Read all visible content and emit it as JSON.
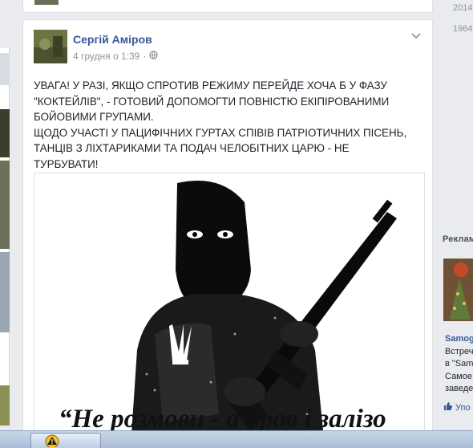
{
  "post": {
    "author": "Сергій Аміров",
    "timestamp": "4 грудня о 1:39",
    "separator": "·",
    "text_lines": [
      "УВАГА! У РАЗІ, ЯКЩО СПРОТИВ РЕЖИМУ ПЕРЕЙДЕ ХОЧА Б У ФАЗУ",
      "\"КОКТЕЙЛІВ\", - ГОТОВИЙ ДОПОМОГТИ ПОВНІСТЮ ЕКІПІРОВАНИМИ",
      "БОЙОВИМИ ГРУПАМИ.",
      "ЩОДО УЧАСТІ У ПАЦИФІЧНИХ ГУРТАХ СПІВІВ ПАТРІОТИЧНИХ ПІСЕНЬ,",
      "ТАНЦІВ З ЛІХТАРИКАМИ ТА ПОДАЧ ЧЕЛОБІТНИХ ЦАРЮ - НЕ",
      "ТУРБУВАТИ!"
    ],
    "image_caption": "“Не розмови - а кров і залізо"
  },
  "timeline_years": [
    "2014",
    "1964"
  ],
  "ads": {
    "heading": "Реклам",
    "title": "Samog",
    "lines": [
      "Встреч",
      "в \"Samo",
      "Самое",
      "заведе"
    ],
    "like_label": "Упо"
  },
  "icons": {
    "globe": "globe-icon",
    "chevron": "chevron-down-icon",
    "like": "thumbs-up-icon",
    "warning": "warning-icon"
  },
  "colors": {
    "link": "#365899",
    "meta": "#90949c",
    "background": "#e9ebee"
  }
}
